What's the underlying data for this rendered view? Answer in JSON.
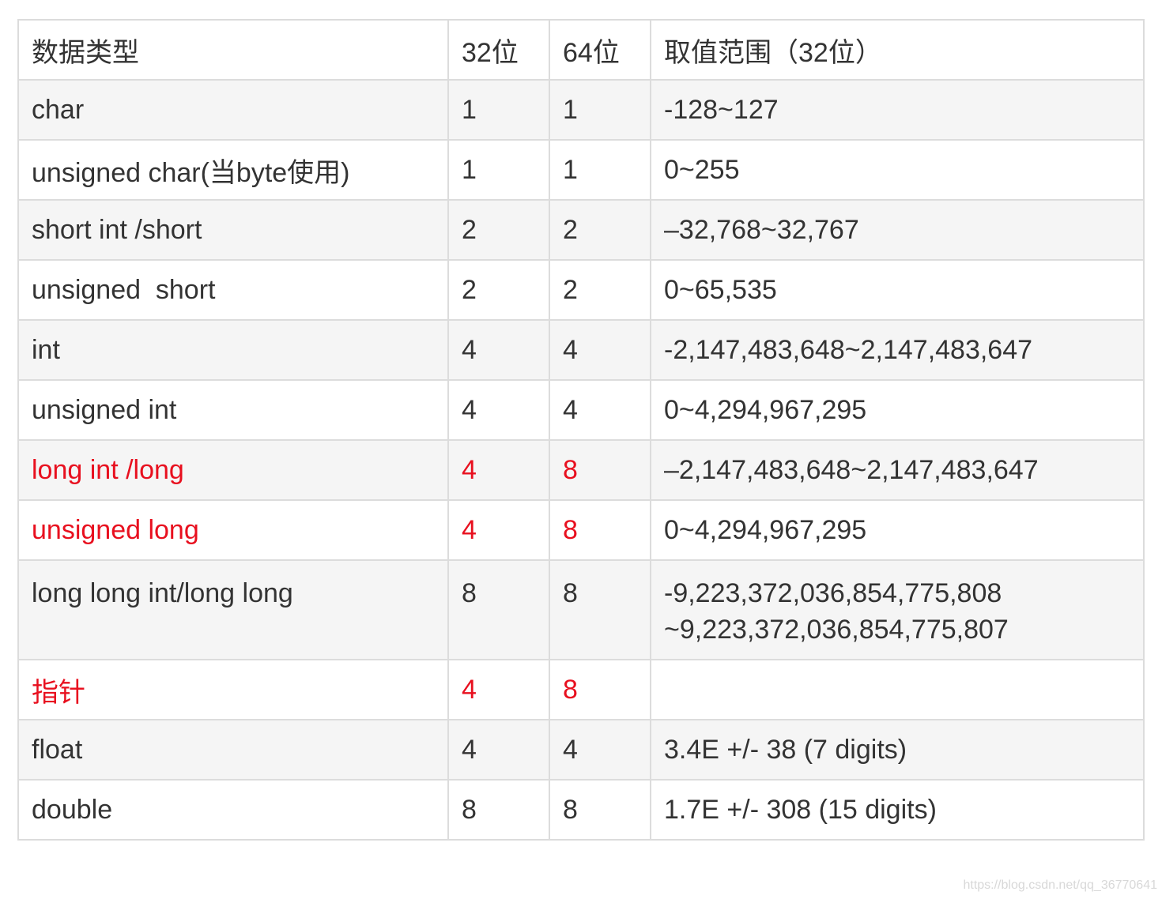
{
  "header": {
    "type": "数据类型",
    "bit32": "32位",
    "bit64": "64位",
    "range": "取值范围（32位）"
  },
  "rows": [
    {
      "type": "char",
      "bit32": "1",
      "bit64": "1",
      "range": "-128~127",
      "highlight": "none"
    },
    {
      "type": "unsigned char(当byte使用)",
      "bit32": "1",
      "bit64": "1",
      "range": "0~255",
      "highlight": "none"
    },
    {
      "type": "short int /short",
      "bit32": "2",
      "bit64": "2",
      "range": "–32,768~32,767",
      "highlight": "none"
    },
    {
      "type": "unsigned  short",
      "bit32": "2",
      "bit64": "2",
      "range": "0~65,535",
      "highlight": "none"
    },
    {
      "type": "int",
      "bit32": "4",
      "bit64": "4",
      "range": "-2,147,483,648~2,147,483,647",
      "highlight": "none"
    },
    {
      "type": "unsigned int",
      "bit32": "4",
      "bit64": "4",
      "range": "0~4,294,967,295",
      "highlight": "none"
    },
    {
      "type": "long int /long",
      "bit32": "4",
      "bit64": "8",
      "range": "–2,147,483,648~2,147,483,647",
      "highlight": "red"
    },
    {
      "type": "unsigned long",
      "bit32": "4",
      "bit64": "8",
      "range": "0~4,294,967,295",
      "highlight": "red"
    },
    {
      "type": "long long int/long long",
      "bit32": "8",
      "bit64": "8",
      "range": "-9,223,372,036,854,775,808",
      "range2": "~9,223,372,036,854,775,807",
      "highlight": "none"
    },
    {
      "type": "指针",
      "bit32": "4",
      "bit64": "8",
      "range": "",
      "highlight": "red"
    },
    {
      "type": "float",
      "bit32": "4",
      "bit64": "4",
      "range": "3.4E +/- 38 (7 digits)",
      "highlight": "none"
    },
    {
      "type": "double",
      "bit32": "8",
      "bit64": "8",
      "range": "1.7E +/- 308 (15 digits)",
      "highlight": "none"
    }
  ],
  "colors": {
    "text": "#333333",
    "highlight": "#e8101f",
    "row_shade": "#f5f5f5",
    "border": "#dcdcdc"
  },
  "watermark": "https://blog.csdn.net/qq_36770641"
}
